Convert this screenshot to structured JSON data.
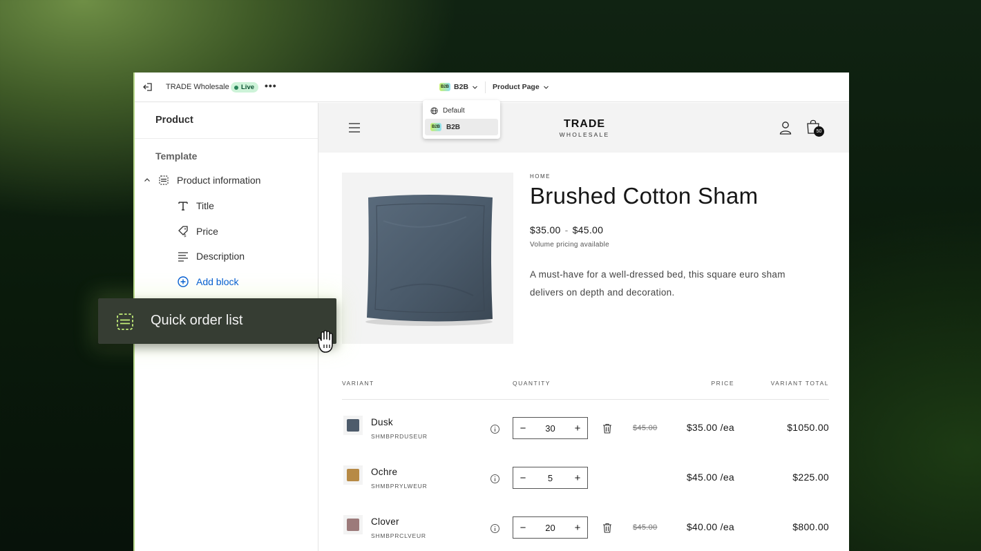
{
  "topbar": {
    "store_name": "TRADE Wholesale",
    "status": "Live",
    "more": "•••",
    "context_chip": "B2B",
    "context_label": "B2B",
    "page_label": "Product Page"
  },
  "context_dropdown": {
    "items": [
      {
        "label": "Default",
        "icon": "globe-icon"
      },
      {
        "label": "B2B",
        "icon": "b2b-chip",
        "selected": true
      }
    ]
  },
  "sidebar": {
    "title": "Product",
    "section": "Template",
    "group_label": "Product information",
    "items": [
      {
        "label": "Title",
        "icon": "text-icon"
      },
      {
        "label": "Price",
        "icon": "price-tag-icon"
      },
      {
        "label": "Description",
        "icon": "paragraph-icon"
      }
    ],
    "add_block": "Add block"
  },
  "drag_chip": {
    "label": "Quick order list",
    "icon": "section-icon"
  },
  "store": {
    "brand_line1": "TRADE",
    "brand_line2": "WHOLESALE",
    "cart_count": "50"
  },
  "product": {
    "breadcrumb": "HOME",
    "title": "Brushed Cotton Sham",
    "price_low": "$35.00",
    "price_sep": "-",
    "price_high": "$45.00",
    "volume_note": "Volume pricing available",
    "description": "A must-have for a well-dressed bed, this square euro sham delivers on depth and decoration."
  },
  "quick_order": {
    "headers": {
      "variant": "VARIANT",
      "quantity": "QUANTITY",
      "price": "PRICE",
      "total": "VARIANT TOTAL"
    },
    "rows": [
      {
        "name": "Dusk",
        "sku": "SHMBPRDUSEUR",
        "qty": "30",
        "old_price": "$45.00",
        "unit_price": "$35.00 /ea",
        "total": "$1050.00",
        "color": "#4d5b6b",
        "removable": true
      },
      {
        "name": "Ochre",
        "sku": "SHMBPRYLWEUR",
        "qty": "5",
        "old_price": "",
        "unit_price": "$45.00 /ea",
        "total": "$225.00",
        "color": "#b78a45",
        "removable": false
      },
      {
        "name": "Clover",
        "sku": "SHMBPRCLVEUR",
        "qty": "20",
        "old_price": "$45.00",
        "unit_price": "$40.00 /ea",
        "total": "$800.00",
        "color": "#9c7a7a",
        "removable": true
      }
    ]
  },
  "colors": {
    "accent_blue": "#005bd3",
    "live_green": "#29845a",
    "pillow": "#4a5a6a"
  }
}
